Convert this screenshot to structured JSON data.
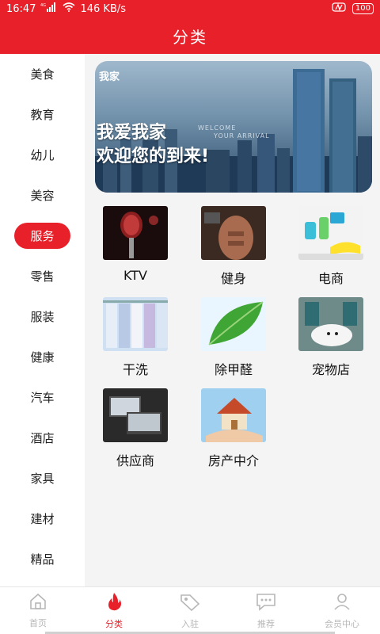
{
  "status_bar": {
    "time": "16:47",
    "network": "4G",
    "speed": "146 KB/s",
    "battery": "100"
  },
  "header": {
    "title": "分类"
  },
  "sidebar": {
    "items": [
      {
        "label": "美食",
        "active": false
      },
      {
        "label": "教育",
        "active": false
      },
      {
        "label": "幼儿",
        "active": false
      },
      {
        "label": "美容",
        "active": false
      },
      {
        "label": "服务",
        "active": true
      },
      {
        "label": "零售",
        "active": false
      },
      {
        "label": "服装",
        "active": false
      },
      {
        "label": "健康",
        "active": false
      },
      {
        "label": "汽车",
        "active": false
      },
      {
        "label": "酒店",
        "active": false
      },
      {
        "label": "家具",
        "active": false
      },
      {
        "label": "建材",
        "active": false
      },
      {
        "label": "精品",
        "active": false
      }
    ]
  },
  "banner": {
    "brand": "我家",
    "line1": "我爱我家",
    "line2": "欢迎您的到来!",
    "welcome": "WELCOME",
    "arrival": "YOUR ARRIVAL"
  },
  "categories": [
    {
      "label": "KTV",
      "icon": "microphone-image"
    },
    {
      "label": "健身",
      "icon": "fitness-image"
    },
    {
      "label": "电商",
      "icon": "cleaning-image"
    },
    {
      "label": "干洗",
      "icon": "shirts-image"
    },
    {
      "label": "除甲醛",
      "icon": "leaf-image"
    },
    {
      "label": "宠物店",
      "icon": "pet-grooming-image"
    },
    {
      "label": "供应商",
      "icon": "laptops-image"
    },
    {
      "label": "房产中介",
      "icon": "house-in-hands-image"
    }
  ],
  "tabbar": {
    "items": [
      {
        "label": "首页",
        "icon": "home-icon",
        "active": false
      },
      {
        "label": "分类",
        "icon": "flame-icon",
        "active": true
      },
      {
        "label": "入驻",
        "icon": "tag-icon",
        "active": false
      },
      {
        "label": "推荐",
        "icon": "chat-icon",
        "active": false
      },
      {
        "label": "会员中心",
        "icon": "user-icon",
        "active": false
      }
    ]
  },
  "colors": {
    "accent": "#e8202a",
    "inactive": "#b7b7b7"
  }
}
